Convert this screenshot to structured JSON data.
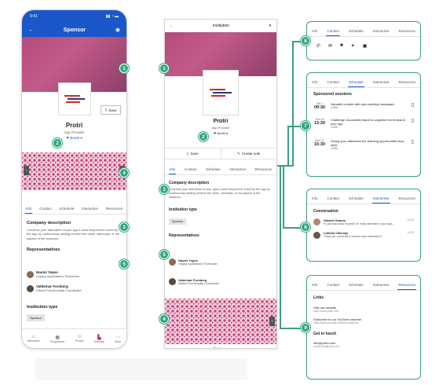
{
  "left": {
    "status_time": "9:41",
    "title": "Sponsor",
    "save": "Save",
    "name": "Protri",
    "subtitle": "App Provider",
    "booth": "Booth 8",
    "tabs": [
      "Info",
      "Contact",
      "Schedule",
      "Interactive",
      "Resources"
    ],
    "company_heading": "Company description",
    "company_text": "Convince your attendees of your app's value beyond the event by the app by continuously adding content like news, webcasts, or full papers of the sessions.",
    "reps_heading": "Representatives",
    "rep1_name": "Naomi Yepes",
    "rep1_role": "Legacy Applications Technician",
    "rep2_name": "Valdemar Forsberg",
    "rep2_role": "District Functionality Coordinator",
    "inst_heading": "Institution type",
    "inst_chip": "Sponsor",
    "nav": [
      "Attendees",
      "Programme",
      "People",
      "Industry",
      "More"
    ]
  },
  "mid": {
    "title": "Institution",
    "name": "Protri",
    "subtitle": "App Provider",
    "booth": "Booth 8",
    "save": "Save",
    "note": "Create note",
    "tabs": [
      "Info",
      "Contact",
      "Schedule",
      "Interactive",
      "Resources"
    ],
    "company_heading": "Company description",
    "company_text": "Convince your attendees of your app's value beyond the event by the app by continuously adding content like news, webcasts, or full papers of the sessions.",
    "inst_heading": "Institution type",
    "inst_chip": "Sponsor",
    "reps_heading": "Representatives",
    "rep1_name": "Naomi Yepes",
    "rep1_role": "Legacy Applications Technician",
    "rep2_name": "Valdemar Forsberg",
    "rep2_role": "District Functionality Coordinator"
  },
  "p6": {
    "tabs": [
      "Info",
      "Contact",
      "Schedule",
      "Interactive",
      "Resources"
    ]
  },
  "p7": {
    "tabs": [
      "Info",
      "Contact",
      "Schedule",
      "Interactive",
      "Resources"
    ],
    "heading": "Sponsored sessions",
    "sessions": [
      {
        "date": "Sat 1",
        "time": "09:30",
        "title": "Valuable content with eye-catching messages",
        "dur": "1:00h"
      },
      {
        "date": "Sun 15",
        "time": "13:30",
        "title": "Challenge: Accurately import & organise event data in your app",
        "dur": "1:30h"
      },
      {
        "date": "Mon 11",
        "time": "15:30",
        "title": "Giving your attendees the learning opportunities they seek",
        "dur": "1:00h"
      }
    ]
  },
  "p8": {
    "tabs": [
      "Info",
      "Contact",
      "Schedule",
      "Interactive",
      "Resources"
    ],
    "heading": "Conversation",
    "msgs": [
      {
        "name": "Gabriel Soares",
        "time": "10:00",
        "text": "Hi, just that would be great! I'm really interested in your appl..."
      },
      {
        "name": "Lidmila Vilensky",
        "time": "10:25",
        "text": "Thank you, would like to answer more information?"
      }
    ]
  },
  "p9": {
    "tabs": [
      "Info",
      "Contact",
      "Schedule",
      "Interactive",
      "Resources"
    ],
    "links": "Links",
    "l1": "Visit our website",
    "l1s": "https://www.protri.com",
    "l2": "Subscribe to our YouTube channel",
    "l2s": "https://www.youtube.com/channel/protri",
    "contact": "Get in touch",
    "c1": "info@protri.com",
    "c1s": "media.info@protri.com"
  },
  "nums": [
    "1",
    "2",
    "3",
    "4",
    "5",
    "6",
    "7",
    "8",
    "9"
  ],
  "colors": {
    "accent": "#1b57c9",
    "callout": "#2fa57a",
    "hero": "#b54b79"
  }
}
